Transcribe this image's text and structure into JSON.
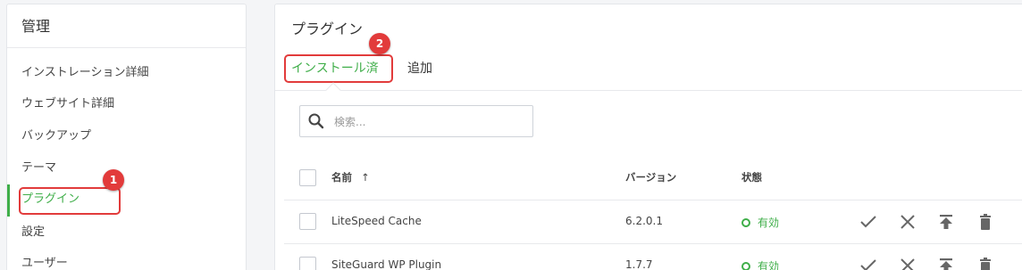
{
  "sidebar": {
    "title": "管理",
    "items": [
      {
        "label": "インストレーション詳細"
      },
      {
        "label": "ウェブサイト詳細"
      },
      {
        "label": "バックアップ"
      },
      {
        "label": "テーマ"
      },
      {
        "label": "プラグイン",
        "active": true
      },
      {
        "label": "設定"
      },
      {
        "label": "ユーザー"
      }
    ]
  },
  "annotations": {
    "badge_1": "1",
    "badge_2": "2"
  },
  "main": {
    "title": "プラグイン",
    "tabs": [
      {
        "label": "インストール済",
        "active": true
      },
      {
        "label": "追加"
      }
    ],
    "search": {
      "placeholder": "検索...",
      "value": ""
    },
    "table": {
      "columns": {
        "name": "名前",
        "sort_indicator": "↑",
        "version": "バージョン",
        "status": "状態"
      },
      "rows": [
        {
          "name": "LiteSpeed Cache",
          "version": "6.2.0.1",
          "status": "有効"
        },
        {
          "name": "SiteGuard WP Plugin",
          "version": "1.7.7",
          "status": "有効"
        }
      ]
    }
  },
  "colors": {
    "accent_green": "#3fae49",
    "annotation_red": "#e23b3b",
    "icon_gray": "#666666"
  },
  "icons": {
    "search": "search-icon",
    "row_actions": [
      "check-icon",
      "close-icon",
      "upload-icon",
      "trash-icon"
    ]
  }
}
